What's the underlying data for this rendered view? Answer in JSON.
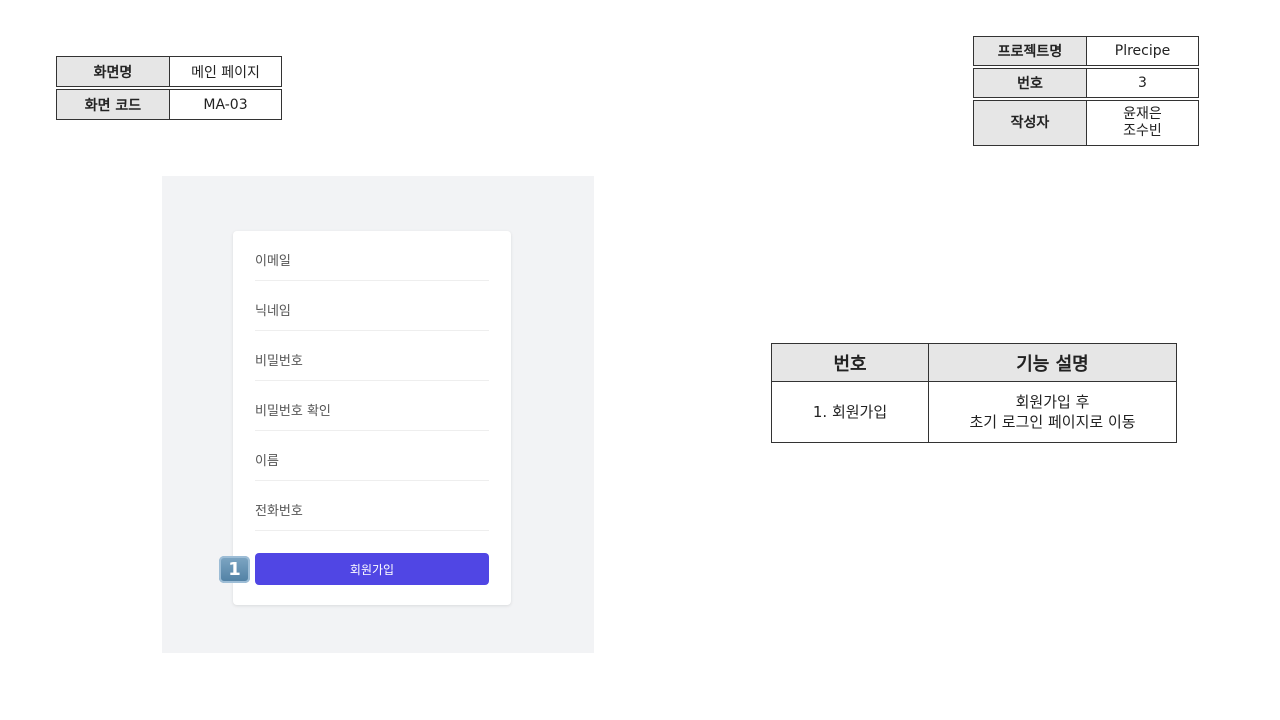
{
  "screen_info": {
    "name_label": "화면명",
    "name_value": "메인 페이지",
    "code_label": "화면 코드",
    "code_value": "MA-03"
  },
  "project_info": {
    "project_label": "프로젝트명",
    "project_value": "Plrecipe",
    "number_label": "번호",
    "number_value": "3",
    "author_label": "작성자",
    "author_line1": "윤재은",
    "author_line2": "조수빈"
  },
  "form": {
    "fields": [
      {
        "label": "이메일"
      },
      {
        "label": "닉네임"
      },
      {
        "label": "비밀번호"
      },
      {
        "label": "비밀번호 확인"
      },
      {
        "label": "이름"
      },
      {
        "label": "전화번호"
      }
    ],
    "submit_label": "회원가입",
    "marker": "1"
  },
  "function_table": {
    "headers": [
      "번호",
      "기능 설명"
    ],
    "rows": [
      {
        "number": "1. 회원가입",
        "desc_line1": "회원가입 후",
        "desc_line2": "초기 로그인 페이지로 이동"
      }
    ]
  }
}
